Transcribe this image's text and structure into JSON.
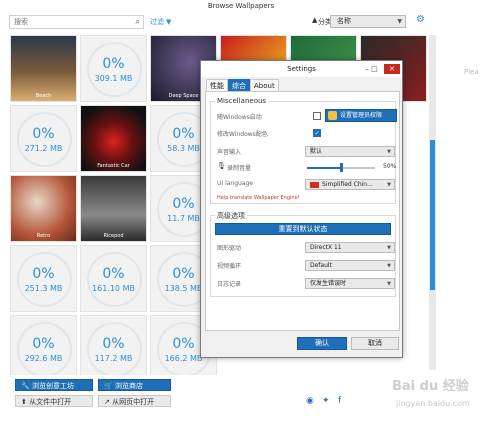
{
  "window": {
    "title": "Browse Wallpapers"
  },
  "toolbar": {
    "search_placeholder": "搜索",
    "filter_label": "过滤",
    "sort_label": "分类",
    "sort_value": "名称"
  },
  "grid": {
    "row1": [
      {
        "caption": "Beach"
      },
      {
        "pct": "0%",
        "size": "309.1 MB"
      },
      {
        "caption": "Deep Space"
      },
      {
        "caption": ""
      },
      {
        "caption": ""
      },
      {
        "caption": ""
      }
    ],
    "row2": [
      {
        "pct": "0%",
        "size": "271.2 MB"
      },
      {
        "caption": "Fantastic Car"
      },
      {
        "pct": "0%",
        "size": "58.3 MB"
      }
    ],
    "row3": [
      {
        "caption": "Retro"
      },
      {
        "caption": "Ricepod"
      },
      {
        "pct": "0%",
        "size": "11.7 MB"
      }
    ],
    "row4": [
      {
        "pct": "0%",
        "size": "251.3 MB"
      },
      {
        "pct": "0%",
        "size": "161.10 MB"
      },
      {
        "pct": "0%",
        "size": "138.5 MB"
      }
    ],
    "row5": [
      {
        "pct": "0%",
        "size": "292.6 MB"
      },
      {
        "pct": "0%",
        "size": "117.2 MB"
      },
      {
        "pct": "0%",
        "size": "166.2 MB"
      }
    ]
  },
  "bottom": {
    "workshop": "浏览创意工坊",
    "store": "浏览商店",
    "open_file": "从文件中打开",
    "open_web": "从网页中打开",
    "social_icons": [
      "steam-icon",
      "twitter-icon",
      "facebook-icon"
    ],
    "right_partial": "Plea"
  },
  "settings": {
    "title": "Settings",
    "tabs": [
      "性能",
      "综合",
      "About"
    ],
    "active_tab": "综合",
    "misc": {
      "title": "Miscellaneous",
      "autostart_label": "随Windows启动",
      "admin_button": "设置管理员权限",
      "winColor_label": "修改Windows配色",
      "audio_label": "声音输入",
      "audio_value": "默认",
      "volume_label": "录制音量",
      "volume_percent": "50%",
      "volume_level": 0.5,
      "ui_label": "UI language",
      "ui_value": "Simplified Chin...",
      "help_link": "Help translate Wallpaper Engine!"
    },
    "advanced": {
      "title": "高级选项",
      "reset_button": "重置到默认状态",
      "renderer_label": "图形驱动",
      "renderer_value": "DirectX 11",
      "video_label": "视频循环",
      "video_value": "Default",
      "log_label": "日志记录",
      "log_value": "仅发生错误时"
    },
    "ok_button": "确认",
    "cancel_button": "取消"
  },
  "watermark": {
    "line1": "Bai du 经验",
    "line2": "jingyan.baidu.com"
  }
}
